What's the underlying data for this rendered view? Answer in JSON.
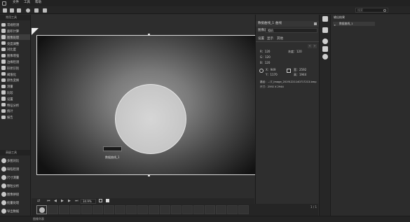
{
  "menubar": {
    "items": [
      "文件",
      "工具",
      "帮助"
    ]
  },
  "toolbar": {
    "search_placeholder": "搜索"
  },
  "sidebar": {
    "section_top": "常用工具",
    "items": [
      {
        "label": "常规检测",
        "icon": "inspect-icon"
      },
      {
        "label": "面积计算",
        "icon": "area-icon"
      },
      {
        "label": "图像处理",
        "icon": "image-process-icon"
      },
      {
        "label": "亮度调整",
        "icon": "brightness-icon"
      },
      {
        "label": "对比度",
        "icon": "contrast-icon"
      },
      {
        "label": "图像增强",
        "icon": "enhance-icon"
      },
      {
        "label": "边缘检测",
        "icon": "edge-icon"
      },
      {
        "label": "形状识别",
        "icon": "shape-icon"
      },
      {
        "label": "阈值化",
        "icon": "threshold-icon"
      },
      {
        "label": "颜色变换",
        "icon": "color-icon"
      },
      {
        "label": "测量",
        "icon": "measure-icon"
      },
      {
        "label": "比较",
        "icon": "compare-icon"
      },
      {
        "label": "设置",
        "icon": "settings-icon"
      },
      {
        "label": "特征分析",
        "icon": "feature-icon"
      },
      {
        "label": "统计",
        "icon": "stats-icon"
      },
      {
        "label": "报告",
        "icon": "report-icon"
      }
    ],
    "section_bottom": "高级工具",
    "items_bottom": [
      {
        "label": "多图对比",
        "icon": "multi-compare-icon"
      },
      {
        "label": "缺陷检测",
        "icon": "defect-icon"
      },
      {
        "label": "尺寸测量",
        "icon": "dimension-icon"
      },
      {
        "label": "颗粒分析",
        "icon": "particle-icon"
      },
      {
        "label": "图像拼接",
        "icon": "stitch-icon"
      },
      {
        "label": "批量处理",
        "icon": "batch-icon"
      },
      {
        "label": "导出数据",
        "icon": "export-icon"
      }
    ]
  },
  "canvas": {
    "chip_label": "数据曲线_1"
  },
  "props": {
    "tab_main": "数据曲线_1",
    "tab_tool": "曲线",
    "subtab": "图像源",
    "subtab_value": "相机",
    "tabs": [
      "设置",
      "显示",
      "其他"
    ],
    "r": "R：120",
    "g": "G：120",
    "b": "B：120",
    "gray": "灰度：120",
    "x": "X：949",
    "y": "Y：1170",
    "w": "宽：2592",
    "h": "高：1944",
    "path": "路径：...\\T_Image_20191221140717213.bmp",
    "size": "尺寸：2592 X 2944"
  },
  "playbar": {
    "zoom": "34.9%",
    "page": "1 / 1"
  },
  "rpanel": {
    "title": "输出结果",
    "item": "数据曲线_1"
  },
  "statusbar": {
    "left": "图像列表"
  }
}
